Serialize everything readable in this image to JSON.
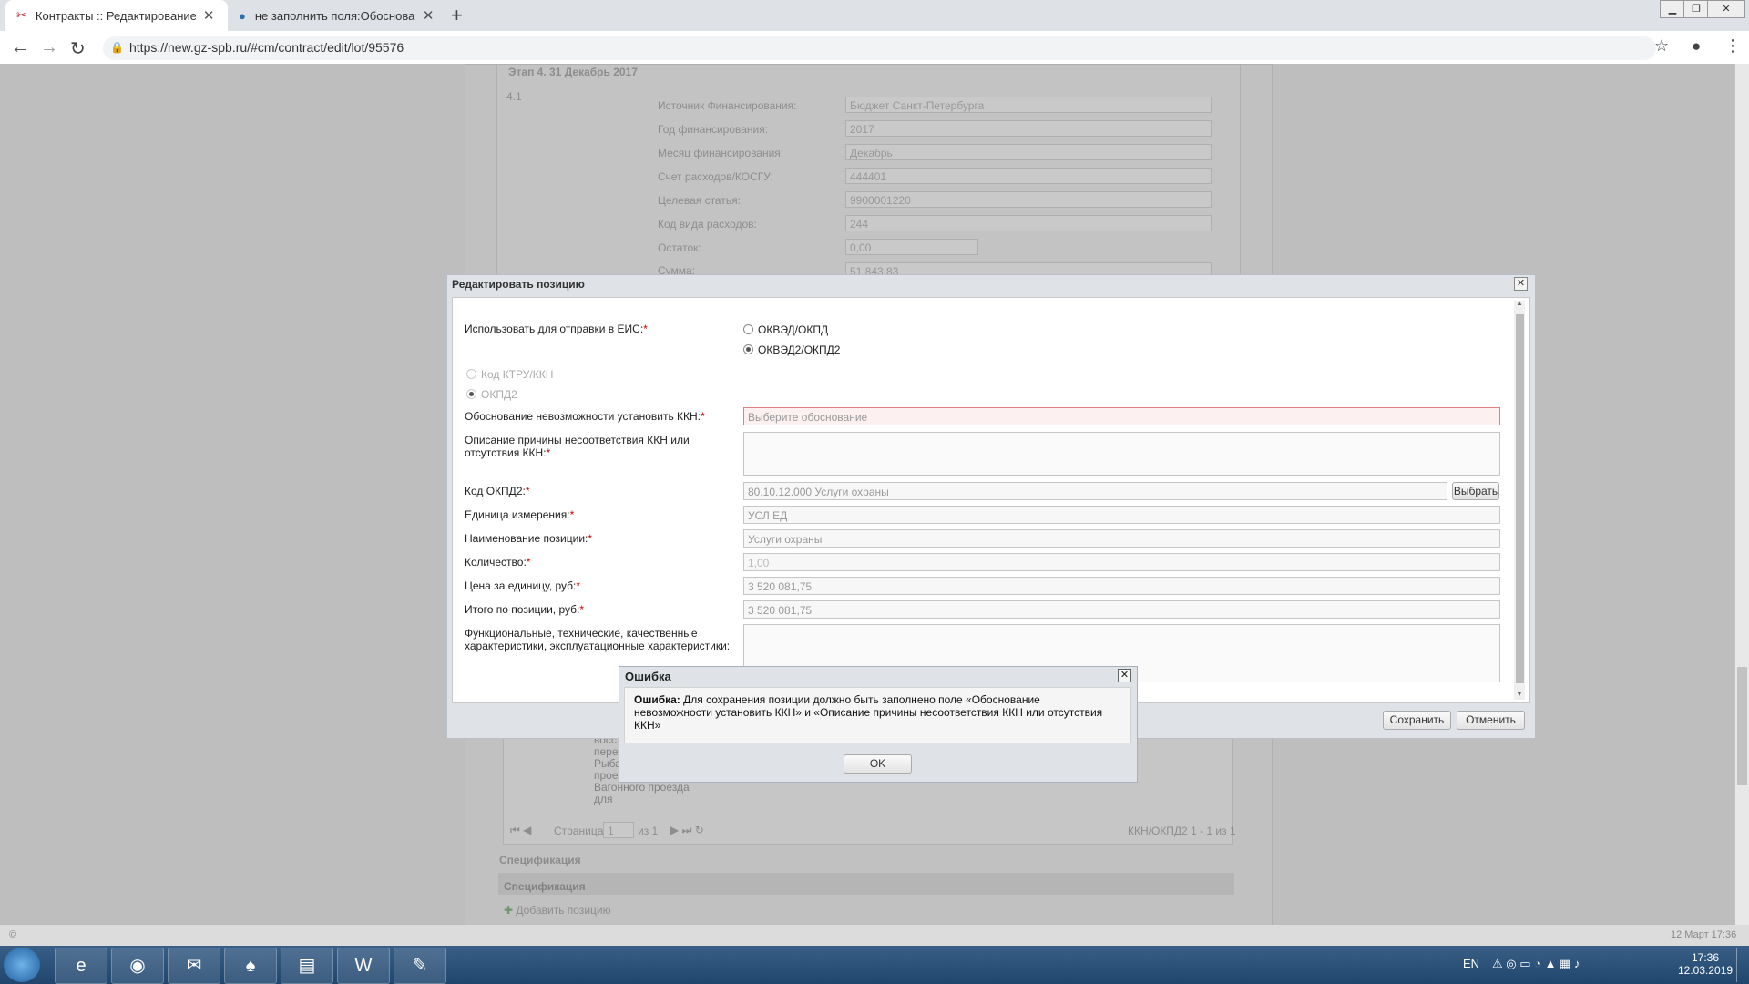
{
  "browser": {
    "tabs": [
      {
        "title": "Контракты :: Редактирование к",
        "icon": "tools-icon"
      },
      {
        "title": "не заполнить поля:Обосновани",
        "icon": "globe-icon"
      }
    ],
    "new_tab": "+",
    "url": "https://new.gz-spb.ru/#cm/contract/edit/lot/95576"
  },
  "background": {
    "stage_title": "Этап 4. 31 Декабрь 2017",
    "stage_num": "4.1",
    "fields": [
      {
        "label": "Источник Финансирования:",
        "value": "Бюджет Санкт-Петербурга"
      },
      {
        "label": "Год финансирования:",
        "value": "2017"
      },
      {
        "label": "Месяц финансирования:",
        "value": "Декабрь"
      },
      {
        "label": "Счет расходов/КОСГУ:",
        "value": "444401"
      },
      {
        "label": "Целевая статья:",
        "value": "9900001220"
      },
      {
        "label": "Код вида расходов:",
        "value": "244"
      },
      {
        "label": "Остаток:",
        "value": "0,00"
      },
      {
        "label": "Сумма:",
        "value": "51 843,83"
      }
    ],
    "grid_text": [
      "восст",
      "перес",
      "Рыба",
      "проезда и",
      "Вагонного проезда",
      "для"
    ],
    "pager": {
      "page_label": "Страница",
      "page": "1",
      "of": "из 1",
      "summary": "ККН/ОКПД2 1 - 1 из 1"
    },
    "spec_title": "Спецификация",
    "spec_header": "Спецификация",
    "add_position": "Добавить позицию"
  },
  "edit_window": {
    "title": "Редактировать позицию",
    "use_for_eis_label": "Использовать для отправки в ЕИС:",
    "radio_okved": "ОКВЭД/ОКПД",
    "radio_okved2": "ОКВЭД2/ОКПД2",
    "radio_ktru": "Код КТРУ/ККН",
    "radio_okpd2": "ОКПД2",
    "justification_label": "Обоснование невозможности установить ККН:",
    "justification_placeholder": "Выберите обоснование",
    "reason_label": "Описание причины несоответствия ККН или отсутствия ККН:",
    "okpd2_label": "Код ОКПД2:",
    "okpd2_value": "80.10.12.000 Услуги охраны",
    "choose_button": "Выбрать",
    "unit_label": "Единица измерения:",
    "unit_value": "УСЛ ЕД",
    "name_label": "Наименование позиции:",
    "name_value": "Услуги охраны",
    "qty_label": "Количество:",
    "qty_value": "1,00",
    "price_label": "Цена за единицу, руб:",
    "price_value": "3 520 081,75",
    "total_label": "Итого по позиции, руб:",
    "total_value": "3 520 081,75",
    "chars_label": "Функциональные, технические, качественные характеристики, эксплуатационные характеристики:",
    "required_mark": "*",
    "save_button": "Сохранить",
    "cancel_button": "Отменить"
  },
  "error_dialog": {
    "title": "Ошибка",
    "bold_prefix": "Ошибка:",
    "message": "Для сохранения позиции должно быть заполнено поле «Обоснование невозможности установить ККН» и «Описание причины несоответствия ККН или отсутствия ККН»",
    "ok_button": "OK"
  },
  "status": {
    "left": "©",
    "right": "12 Март 17:36"
  },
  "taskbar": {
    "apps": [
      "start-orb-icon",
      "ie-icon",
      "chrome-icon",
      "outlook-icon",
      "acrobat-icon",
      "folder-icon",
      "word-icon",
      "paint-icon"
    ],
    "lang": "EN",
    "time": "17:36",
    "date": "12.03.2019"
  }
}
